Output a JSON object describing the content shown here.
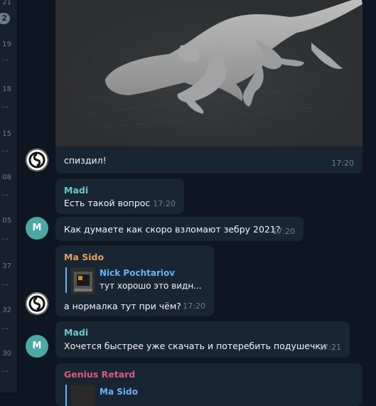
{
  "sidebar": {
    "times": [
      "21",
      "19",
      "18",
      "15",
      "08",
      "05",
      "37",
      "32",
      "30"
    ],
    "badge": "2"
  },
  "messages": [
    {
      "id": "m1",
      "text": "спиздил!",
      "time": "17:20"
    },
    {
      "id": "m2",
      "sender": "Madi",
      "text": "Есть такой вопрос",
      "time": "17:20"
    },
    {
      "id": "m3",
      "avatar_letter": "M",
      "text": "Как думаете как скоро взломают зебру 2021?",
      "time": "17:20"
    },
    {
      "id": "m4",
      "sender": "Ma Sido",
      "reply_author": "Nick Pochtariov",
      "reply_text": "тут хорошо это видн...",
      "text": "а нормалка тут при чём?",
      "time": "17:20"
    },
    {
      "id": "m5",
      "sender": "Madi",
      "avatar_letter": "M",
      "text": "Хочется быстрее уже скачать и потеребить подушечки",
      "time": "17:21"
    },
    {
      "id": "m6",
      "sender": "Genius Retard",
      "reply_author": "Ma Sido"
    }
  ],
  "colors": {
    "background": "#0e1621",
    "bubble": "#182533",
    "madi": "#6ec9cb",
    "ma_sido": "#e8a05c",
    "genius_retard": "#e05a7e",
    "reply_accent": "#6ab2f2"
  },
  "icons": [
    "chat-logo-icon",
    "lizard-3d-render"
  ]
}
